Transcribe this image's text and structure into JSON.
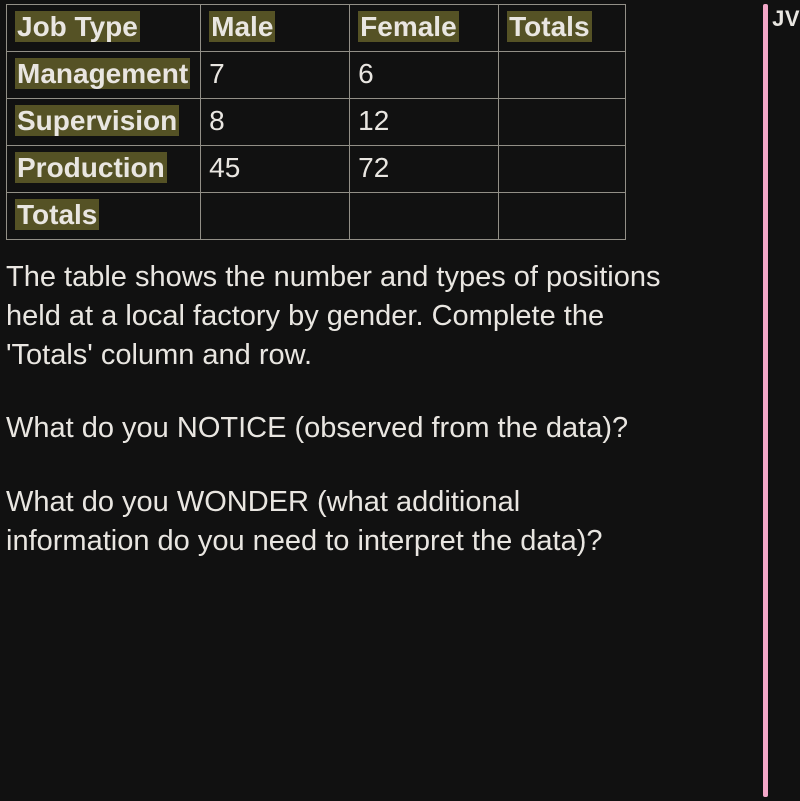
{
  "corner_label": "JV",
  "table": {
    "headers": {
      "job_type": "Job Type",
      "male": "Male",
      "female": "Female",
      "totals": "Totals"
    },
    "rows": [
      {
        "label": "Management",
        "male": "7",
        "female": "6",
        "totals": ""
      },
      {
        "label": "Supervision",
        "male": "8",
        "female": "12",
        "totals": ""
      },
      {
        "label": "Production",
        "male": "45",
        "female": "72",
        "totals": ""
      }
    ],
    "footer": {
      "label": "Totals",
      "male": "",
      "female": "",
      "totals": ""
    }
  },
  "paragraphs": {
    "intro": "The table shows the number and types of positions held at a local factory by gender. Complete the 'Totals' column and row.",
    "notice": "What do you NOTICE (observed from the data)?",
    "wonder": "What do you WONDER (what additional information do you need to interpret the data)?"
  }
}
